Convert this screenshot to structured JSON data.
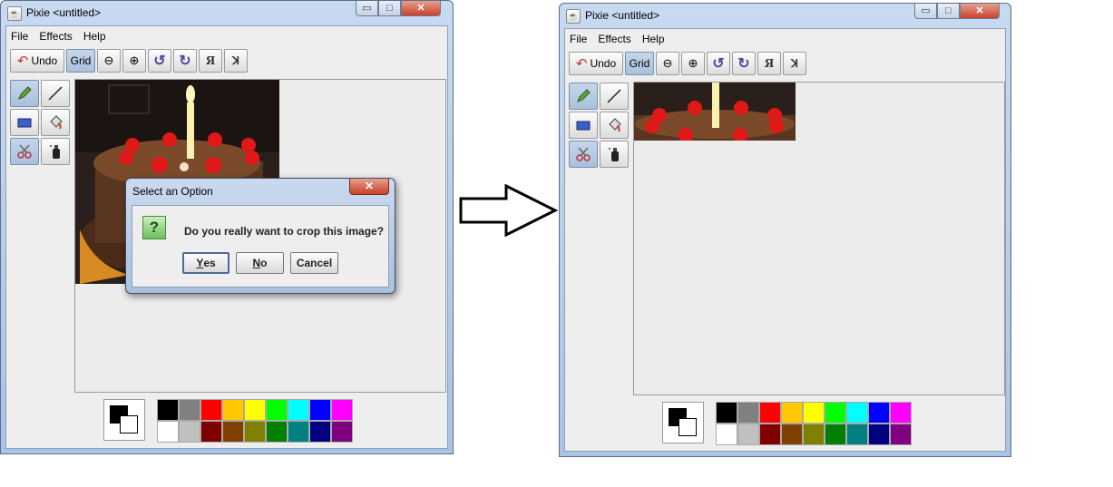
{
  "windows": [
    {
      "id": "before",
      "title": "Pixie <untitled>",
      "menu": [
        "File",
        "Effects",
        "Help"
      ],
      "toolbar": {
        "undo": "Undo",
        "grid": "Grid"
      },
      "dialog": {
        "title": "Select an Option",
        "message": "Do you really want to crop this image?",
        "yes_mnemonic": "Y",
        "yes_rest": "es",
        "no_mnemonic": "N",
        "no_rest": "o",
        "cancel": "Cancel"
      }
    },
    {
      "id": "after",
      "title": "Pixie <untitled>",
      "menu": [
        "File",
        "Effects",
        "Help"
      ],
      "toolbar": {
        "undo": "Undo",
        "grid": "Grid"
      }
    }
  ],
  "window_controls": {
    "minimize": "▭",
    "maximize": "□",
    "close": "✕"
  },
  "toolbar_glyphs": {
    "zoom_out": "⊖",
    "zoom_in": "⊕",
    "rotate_left": "↺",
    "rotate_right": "↻",
    "flip_h": "Я",
    "flip_v": "ꓘ"
  },
  "icons": [
    "java-cup-icon",
    "undo-arrow-icon",
    "zoom-out-icon",
    "zoom-in-icon",
    "rotate-left-icon",
    "rotate-right-icon",
    "flip-horizontal-icon",
    "flip-vertical-icon",
    "pencil-icon",
    "line-icon",
    "rectangle-icon",
    "fill-bucket-icon",
    "scissors-icon",
    "spray-can-icon",
    "question-icon",
    "right-arrow-icon"
  ],
  "palette": {
    "top": [
      "#000000",
      "#808080",
      "#ff0000",
      "#ffc800",
      "#ffff00",
      "#00ff00",
      "#00ffff",
      "#0000ff",
      "#ff00ff"
    ],
    "bottom": [
      "#ffffff",
      "#c0c0c0",
      "#800000",
      "#804000",
      "#808000",
      "#008000",
      "#008080",
      "#000080",
      "#800080"
    ]
  },
  "current_colors": {
    "foreground": "#000000",
    "background": "#ffffff"
  }
}
